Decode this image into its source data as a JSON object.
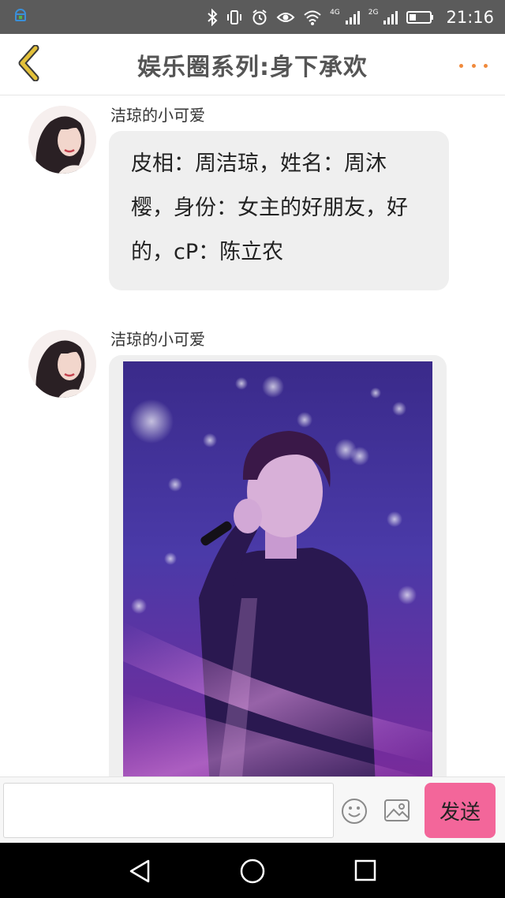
{
  "status_bar": {
    "time": "21:16",
    "network_1": "4G",
    "network_2": "2G",
    "icons": [
      "app-notification-icon",
      "bluetooth-icon",
      "vibrate-icon",
      "alarm-icon",
      "eye-icon",
      "wifi-icon",
      "signal-icon",
      "signal-icon",
      "battery-icon"
    ]
  },
  "header": {
    "title": "娱乐圈系列:身下承欢",
    "back_icon": "chevron-left-icon",
    "more_icon": "more-dots-icon",
    "back_color": "#e3c13a",
    "more_color": "#f08a3c"
  },
  "messages": [
    {
      "sender": "洁琼的小可爱",
      "type": "text",
      "text": "皮相：周洁琼，姓名：周沐樱，身份：女主的好朋友，好的，cP：陈立农"
    },
    {
      "sender": "洁琼的小可爱",
      "type": "image",
      "image_subject": "singer-photo"
    }
  ],
  "input_bar": {
    "placeholder": "",
    "value": "",
    "emoji_icon": "emoji-icon",
    "image_icon": "image-icon",
    "send_label": "发送",
    "send_color": "#f3669a"
  },
  "nav_bar": {
    "icons": [
      "nav-back-icon",
      "nav-home-icon",
      "nav-recent-icon"
    ]
  }
}
